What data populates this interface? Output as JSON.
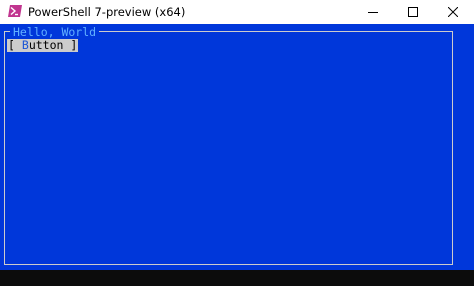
{
  "window": {
    "title": "PowerShell 7-preview (x64)",
    "icon": "powershell-icon",
    "controls": [
      "minimize-icon",
      "maximize-icon",
      "close-icon"
    ]
  },
  "console": {
    "background": "#0037da",
    "frame": {
      "title": "Hello, World"
    },
    "button": {
      "open_bracket": "[",
      "hotkey": "B",
      "rest": "utton",
      "close_bracket": "]"
    }
  },
  "colors": {
    "console_bg": "#0037da",
    "frame_title": "#61b0ff",
    "button_bg": "#cccccc",
    "hotkey": "#1a56d6"
  }
}
